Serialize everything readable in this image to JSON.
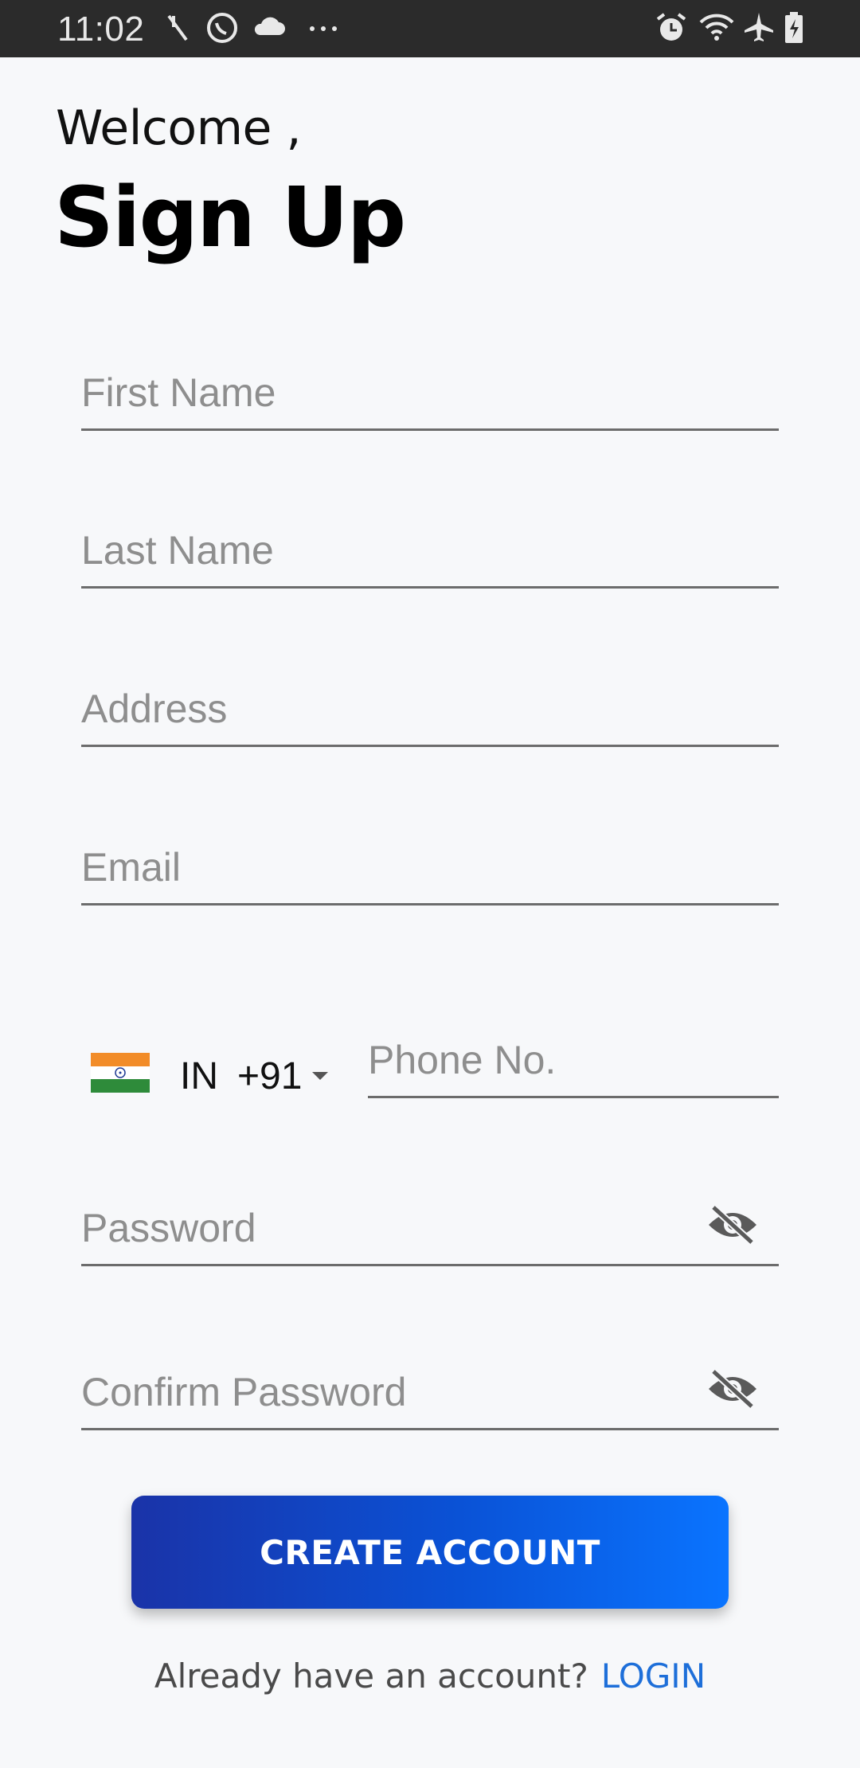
{
  "status_bar": {
    "time": "11:02",
    "left_icons": [
      "signal-slash-icon",
      "whatsapp-icon",
      "cloud-icon",
      "more-icon"
    ],
    "right_icons": [
      "alarm-icon",
      "wifi-icon",
      "airplane-icon",
      "battery-charging-icon"
    ]
  },
  "header": {
    "greeting": "Welcome ,",
    "title": "Sign Up"
  },
  "form": {
    "first_name": {
      "placeholder": "First Name",
      "value": ""
    },
    "last_name": {
      "placeholder": "Last Name",
      "value": ""
    },
    "address": {
      "placeholder": "Address",
      "value": ""
    },
    "email": {
      "placeholder": "Email",
      "value": ""
    },
    "phone": {
      "country_code": "IN",
      "dial_code": "+91",
      "flag": "india-flag-icon",
      "placeholder": "Phone No.",
      "value": ""
    },
    "password": {
      "placeholder": "Password",
      "value": "",
      "toggle_icon": "eye-off-icon"
    },
    "confirm_password": {
      "placeholder": "Confirm Password",
      "value": "",
      "toggle_icon": "eye-off-icon"
    }
  },
  "actions": {
    "create_account_label": "CREATE ACCOUNT"
  },
  "footer": {
    "prompt": "Already have an account?",
    "login_label": "LOGIN"
  },
  "colors": {
    "background": "#f7f8fa",
    "button_gradient_start": "#1a33a8",
    "button_gradient_end": "#0a74ff",
    "link": "#1e6fd9"
  }
}
